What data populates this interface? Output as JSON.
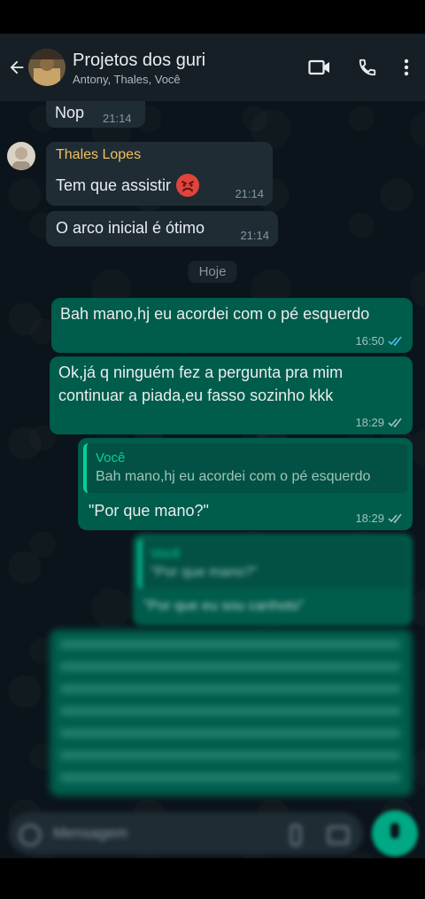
{
  "header": {
    "title": "Projetos dos guri",
    "subtitle": "Antony, Thales, Você"
  },
  "date_divider": "Hoje",
  "messages": [
    {
      "text": "Nop",
      "time": "21:14"
    },
    {
      "author": "Thales Lopes",
      "text": "Tem que assistir",
      "emoji": "😡",
      "time": "21:14"
    },
    {
      "text": "O arco inicial é ótimo",
      "time": "21:14"
    },
    {
      "text": "Bah mano,hj eu acordei com o pé esquerdo",
      "time": "16:50"
    },
    {
      "text_line1": "Ok,já q ninguém fez a pergunta pra mim",
      "text_line2": "continuar a piada,eu fasso sozinho kkk",
      "time": "18:29"
    },
    {
      "quote_author": "Você",
      "quote_text": "Bah mano,hj eu acordei com o pé esquerdo",
      "text": "\"Por que mano?\"",
      "time": "18:29"
    },
    {
      "quote_author": "Você",
      "quote_text": "\"Por que mano?\"",
      "text": "\"Por que eu sou canhoto\""
    }
  ],
  "composer": {
    "placeholder": "Mensagem"
  },
  "colors": {
    "outgoing": "#005c4b",
    "incoming": "#1f2c34",
    "accent": "#06cf9c",
    "author": "#f0c060"
  }
}
